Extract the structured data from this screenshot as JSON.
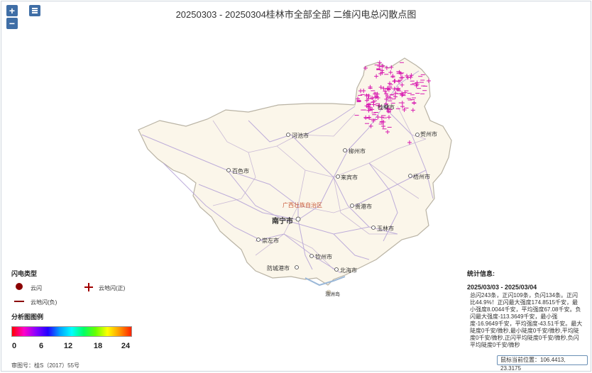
{
  "title": "20250303 - 20250304桂林市全部全部 二维闪电总闪散点图",
  "controls": {
    "zoom_in": "+",
    "zoom_out": "−"
  },
  "map": {
    "region_label": "广西壮族自治区",
    "island_label": "涠洲岛",
    "cities": {
      "guilin": "桂林市",
      "hechi": "河池市",
      "liuzhou": "柳州市",
      "hezhou": "贺州市",
      "baise": "百色市",
      "laibin": "来宾市",
      "wuzhou": "梧州市",
      "guigang": "贵港市",
      "nanning": "南宁市",
      "yulin": "玉林市",
      "chongzuo": "崇左市",
      "qinzhou": "钦州市",
      "fangchenggang": "防城港市",
      "beihai": "北海市"
    }
  },
  "legend": {
    "title": "闪电类型",
    "cloud": "云闪",
    "cg_pos": "云地闪(正)",
    "cg_neg": "云地闪(负)",
    "analysis_title": "分析图图例",
    "ticks": [
      "0",
      "6",
      "12",
      "18",
      "24"
    ],
    "colors": {
      "cloud": "#8b0000",
      "positive": "#a00000",
      "negative": "#8b0000"
    }
  },
  "stats": {
    "title": "统计信息:",
    "range": "2025/03/03 - 2025/03/04",
    "body": "总闪243条，正闪109条，负闪134条。正闪比44.9%！正闪最大强度174.8515千安，最小强度8.0044千安，平均强度67.08千安。负闪最大强度-113.3649千安，最小强度-16.9649千安，平均强度-43.51千安。最大陡度0千安/微秒,最小陡度0千安/微秒,平均陡度0千安/微秒,正闪平均陡度0千安/微秒,负闪平均陡度0千安/微秒"
  },
  "coord_readout": "鼠标当前位置：106.4413, 23.3175",
  "footer": "审图号：桂S（2017）55号",
  "strike_color": "#d81bb0"
}
